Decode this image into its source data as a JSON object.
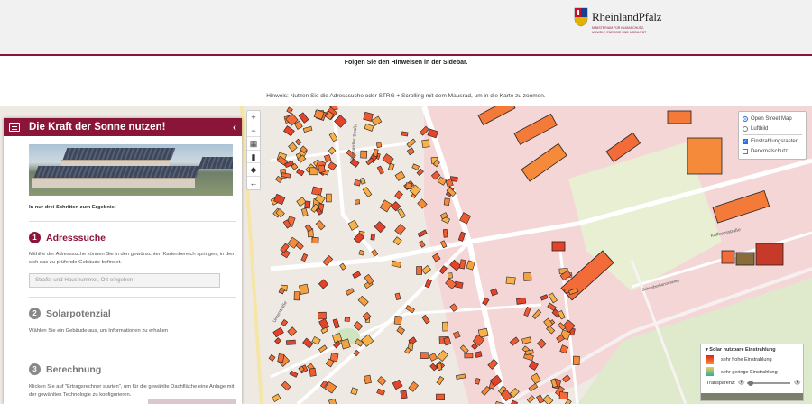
{
  "header": {
    "logo_name": "RheinlandPfalz",
    "logo_subtitle": "Ministerium für Klimaschutz, Umwelt, Energie und Mobilität",
    "notice": "Folgen Sie den Hinweisen in der Sidebar.",
    "hint": "Hinweis: Nutzen Sie die Adresssuche oder STRG + Scrolling mit dem Mausrad, um in die Karte zu zoomen."
  },
  "sidebar": {
    "title": "Die Kraft der Sonne nutzen!",
    "collapse_icon": "chevron-left-icon",
    "intro": "In nur drei Schritten zum Ergebnis!",
    "steps": [
      {
        "number": "1",
        "label": "Adresssuche",
        "description": "Mithilfe der Adresssuche können Sie in den gewünschten Kartenbereich springen, in dem sich das zu prüfende Gebäude befindet."
      },
      {
        "number": "2",
        "label": "Solarpotenzial",
        "description": "Wählen Sie ein Gebäude aus, um Informationen zu erhalten"
      },
      {
        "number": "3",
        "label": "Berechnung",
        "description": "Klicken Sie auf \"Ertragsrechner starten\", um für die gewählte Dachfläche eine Anlage mit der gewählten Technologie zu konfigurieren."
      }
    ],
    "search": {
      "placeholder": "Straße und Hausnummer, Ort eingeben"
    }
  },
  "map_controls": {
    "zoom_in": "+",
    "zoom_out": "−",
    "buttons": [
      "layers-icon",
      "book-icon",
      "location-icon",
      "back-arrow-icon"
    ]
  },
  "layer_switcher": {
    "base_layers": [
      {
        "label": "Open Street Map",
        "selected": true
      },
      {
        "label": "Luftbild",
        "selected": false
      }
    ],
    "overlays": [
      {
        "label": "Einstrahlungsraster",
        "checked": true
      },
      {
        "label": "Denkmalschutz",
        "checked": false
      }
    ]
  },
  "map_labels": {
    "streets": [
      "Boppardter Straße",
      "Kaffeensstraße",
      "Schreiberhannesweg",
      "Unterstraße"
    ]
  },
  "legend": {
    "title": "Solar nutzbare Einstrahlung",
    "high_label": "sehr hohe Einstrahlung",
    "low_label": "sehr geringe Einstrahlung",
    "transparency_label": "Transparenz",
    "transparency": 0.05,
    "colors": {
      "high": "#e11d1d",
      "mid": "#f59a2c",
      "low": "#2bb0a0"
    }
  },
  "colors": {
    "brand": "#8a1538"
  }
}
